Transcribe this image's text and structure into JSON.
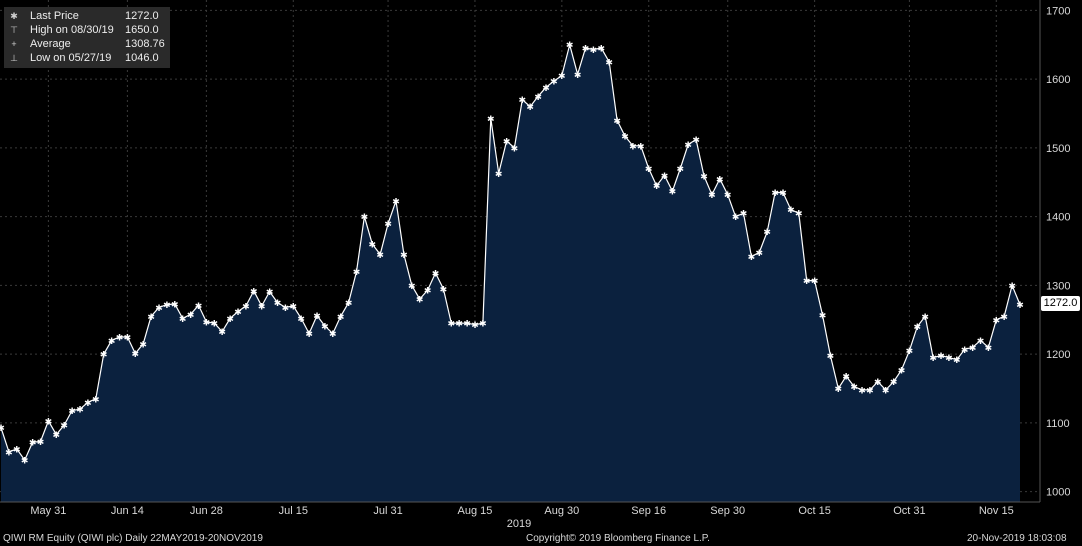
{
  "legend": {
    "items": [
      {
        "icon": "star-icon",
        "glyph": "✱",
        "name": "Last Price",
        "value": "1272.0"
      },
      {
        "icon": "high-marker-icon",
        "glyph": "⊤",
        "name": "High on 08/30/19",
        "value": "1650.0"
      },
      {
        "icon": "average-line-icon",
        "glyph": "+",
        "name": "Average",
        "value": "1308.76"
      },
      {
        "icon": "low-marker-icon",
        "glyph": "⊥",
        "name": "Low on 05/27/19",
        "value": "1046.0"
      }
    ]
  },
  "last_tag": "1272.0",
  "footer": {
    "left": "QIWI RM Equity (QIWI plc)  Daily 22MAY2019-20NOV2019",
    "center": "Copyright© 2019 Bloomberg Finance L.P.",
    "right": "20-Nov-2019 18:03:08"
  },
  "colors": {
    "area_fill": "#0b213e",
    "line": "#ffffff",
    "grid": "#3a3a3a",
    "background": "#000000"
  },
  "chart_data": {
    "type": "area",
    "year_label": "2019",
    "ylim": [
      985,
      1715
    ],
    "yticks": [
      1000,
      1100,
      1200,
      1300,
      1400,
      1500,
      1600,
      1700
    ],
    "xticks": [
      {
        "label": "May 31",
        "index": 6
      },
      {
        "label": "Jun 14",
        "index": 16
      },
      {
        "label": "Jun 28",
        "index": 26
      },
      {
        "label": "Jul 15",
        "index": 37
      },
      {
        "label": "Jul 31",
        "index": 49
      },
      {
        "label": "Aug 15",
        "index": 60
      },
      {
        "label": "Aug 30",
        "index": 71
      },
      {
        "label": "Sep 16",
        "index": 82
      },
      {
        "label": "Sep 30",
        "index": 92
      },
      {
        "label": "Oct 15",
        "index": 103
      },
      {
        "label": "Oct 31",
        "index": 115
      },
      {
        "label": "Nov 15",
        "index": 126
      }
    ],
    "series": [
      {
        "values": [
          1093,
          1058,
          1062,
          1046,
          1072,
          1073,
          1103,
          1083,
          1097,
          1118,
          1120,
          1130,
          1135,
          1200,
          1220,
          1225,
          1225,
          1201,
          1215,
          1255,
          1268,
          1272,
          1273,
          1252,
          1258,
          1271,
          1247,
          1245,
          1233,
          1252,
          1262,
          1270,
          1292,
          1270,
          1291,
          1275,
          1268,
          1270,
          1252,
          1230,
          1256,
          1241,
          1230,
          1255,
          1275,
          1320,
          1400,
          1360,
          1345,
          1390,
          1423,
          1345,
          1300,
          1280,
          1293,
          1318,
          1295,
          1245,
          1245,
          1245,
          1243,
          1245,
          1543,
          1463,
          1510,
          1500,
          1570,
          1560,
          1575,
          1588,
          1597,
          1605,
          1650,
          1607,
          1645,
          1643,
          1645,
          1625,
          1540,
          1517,
          1503,
          1503,
          1470,
          1445,
          1460,
          1437,
          1470,
          1505,
          1512,
          1459,
          1432,
          1455,
          1432,
          1400,
          1405,
          1342,
          1348,
          1378,
          1435,
          1435,
          1410,
          1405,
          1307,
          1307,
          1257,
          1198,
          1150,
          1168,
          1153,
          1148,
          1148,
          1160,
          1148,
          1160,
          1177,
          1205,
          1240,
          1255,
          1195,
          1198,
          1195,
          1192,
          1207,
          1210,
          1220,
          1210,
          1250,
          1255,
          1300,
          1272
        ]
      }
    ]
  }
}
